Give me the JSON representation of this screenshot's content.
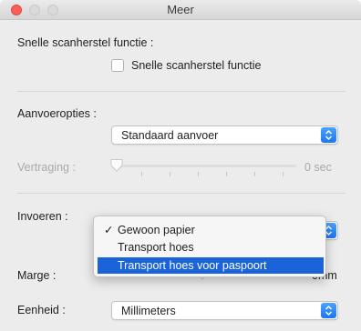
{
  "window": {
    "title": "Meer"
  },
  "sections": {
    "quick_scan": {
      "heading": "Snelle scanherstel functie :",
      "checkbox_label": "Snelle scanherstel functie",
      "checked": false
    },
    "feed_options": {
      "heading": "Aanvoeropties :",
      "selected": "Standaard aanvoer",
      "delay_label": "Vertraging :",
      "delay_value": "0 sec"
    },
    "input": {
      "heading": "Invoeren :",
      "menu_items": [
        {
          "label": "Gewoon papier",
          "checked": true
        },
        {
          "label": "Transport hoes",
          "checked": false
        },
        {
          "label": "Transport hoes voor paspoort",
          "checked": false
        }
      ],
      "checkmark": "✓"
    },
    "margin": {
      "label": "Marge :",
      "value_unit": "0mm"
    },
    "unit": {
      "label": "Eenheid :",
      "selected": "Millimeters"
    }
  },
  "colors": {
    "accent": "#1a63d9",
    "popup_arrows": "#1b76f2",
    "close_button": "#fc5f57",
    "disabled_text": "#a9a9a9"
  }
}
